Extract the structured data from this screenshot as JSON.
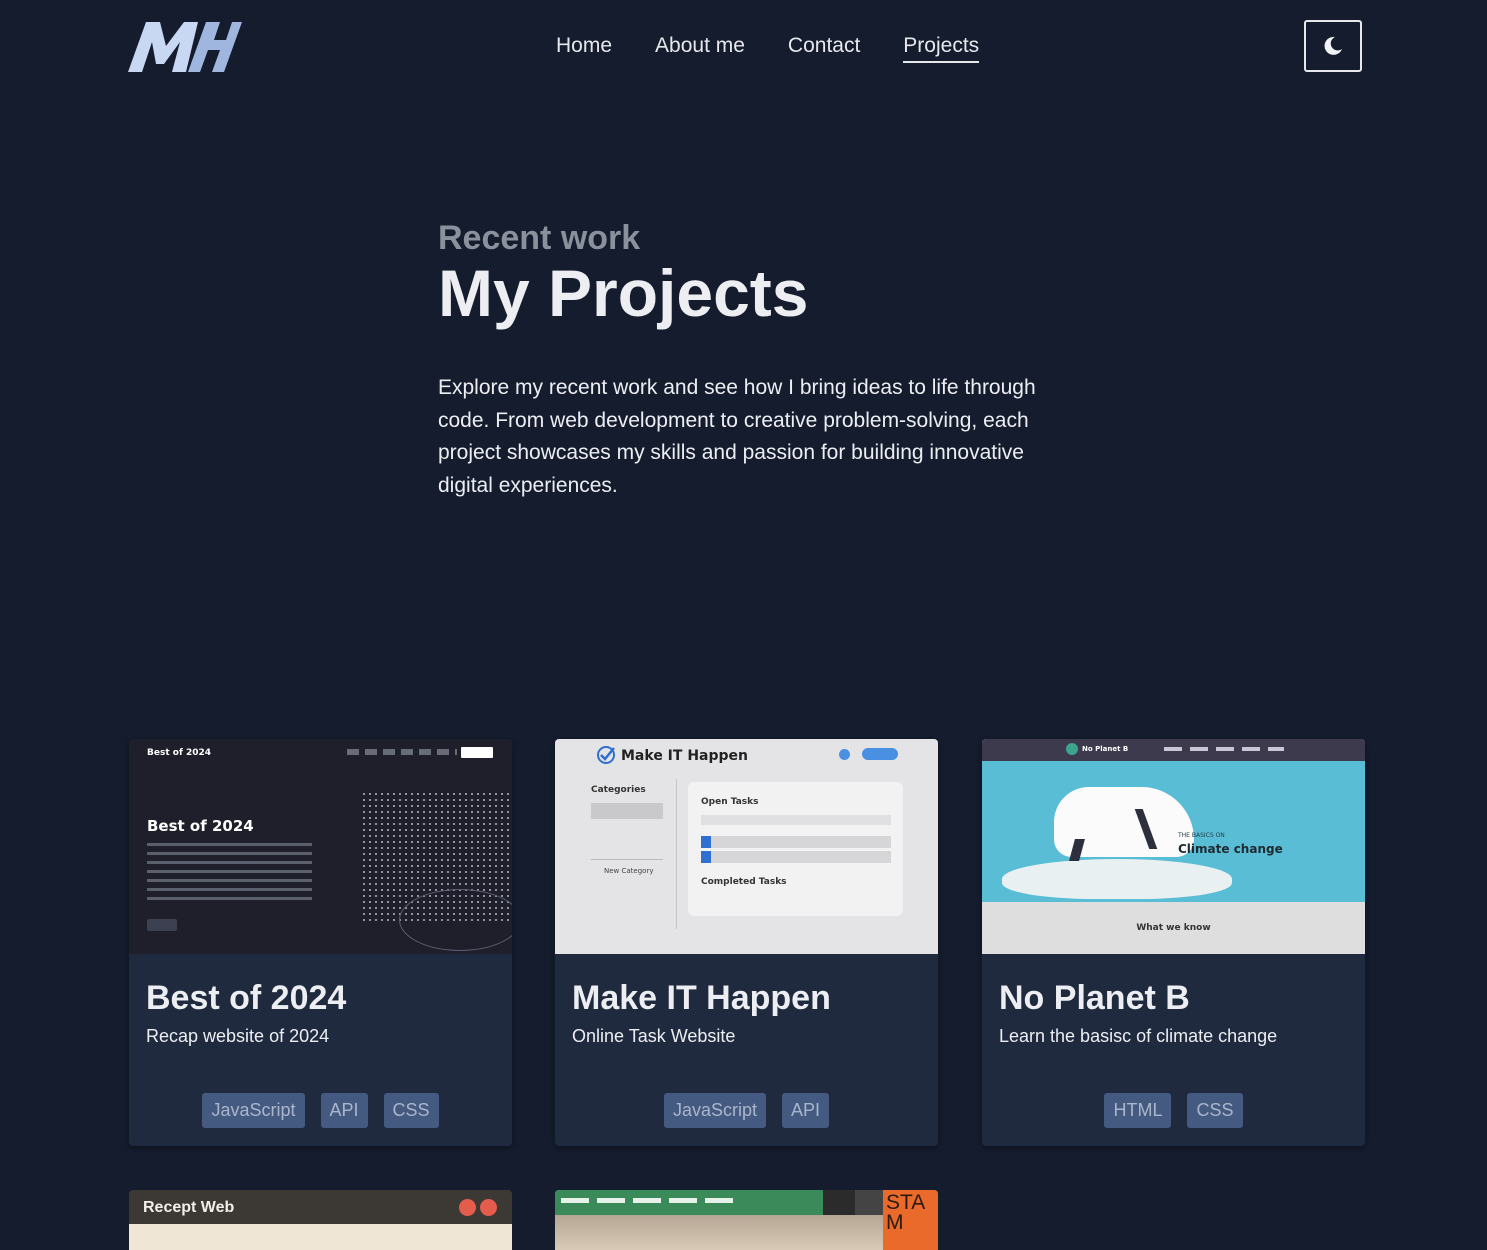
{
  "header": {
    "logo_text": "MH",
    "nav": [
      "Home",
      "About me",
      "Contact",
      "Projects"
    ],
    "active_nav": "Projects",
    "theme_icon": "moon-icon"
  },
  "hero": {
    "eyebrow": "Recent work",
    "title": "My Projects",
    "description": "Explore my recent work and see how I bring ideas to life through code. From web development to creative problem-solving, each project showcases my skills and passion for building innovative digital experiences."
  },
  "projects": [
    {
      "title": "Best of 2024",
      "subtitle": "Recap website of 2024",
      "tags": [
        "JavaScript",
        "API",
        "CSS"
      ],
      "preview": {
        "site_title": "Best of 2024",
        "heading": "Best of 2024"
      }
    },
    {
      "title": "Make IT Happen",
      "subtitle": "Online Task Website",
      "tags": [
        "JavaScript",
        "API"
      ],
      "preview": {
        "site_title": "Make IT Happen",
        "categories_label": "Categories",
        "new_category": "New Category",
        "open_tasks": "Open Tasks",
        "completed_tasks": "Completed Tasks"
      }
    },
    {
      "title": "No Planet B",
      "subtitle": "Learn the basisc of climate change",
      "tags": [
        "HTML",
        "CSS"
      ],
      "preview": {
        "site_title": "No Planet B",
        "kicker": "THE BASICS ON",
        "headline": "Climate change",
        "section": "What we know"
      }
    }
  ],
  "partial_cards": [
    {
      "title": "Recept Web"
    },
    {
      "badge": "STAM"
    }
  ],
  "colors": {
    "background": "#141c2e",
    "card": "#1f2a3e",
    "tag_bg": "#455a80",
    "tag_text": "#aab6cb"
  }
}
